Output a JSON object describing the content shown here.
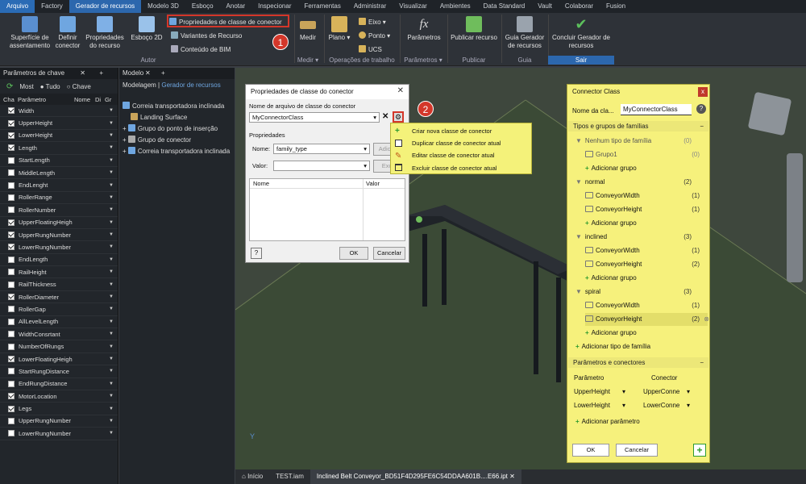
{
  "menubar": [
    "Arquivo",
    "Factory",
    "Gerador de recursos",
    "Modelo 3D",
    "Esboço",
    "Anotar",
    "Inspecionar",
    "Ferramentas",
    "Administrar",
    "Visualizar",
    "Ambientes",
    "Data Standard",
    "Vault",
    "Colaborar",
    "Fusion"
  ],
  "ribbon": {
    "superficie": "Superfície de assentamento",
    "definir": "Definir conector",
    "propriedades": "Propriedades do recurso",
    "esboco2d": "Esboço 2D",
    "prop_classe": "Propriedades de classe de conector",
    "variantes": "Variantes de Recurso",
    "conteudo": "Conteúdo de BIM",
    "autor": "Autor",
    "medir": "Medir",
    "medir_grp": "Medir",
    "plano": "Plano",
    "eixo": "Eixo",
    "ponto": "Ponto",
    "ucs": "UCS",
    "operacoes": "Operações de trabalho",
    "parametros": "Parâmetros",
    "parametros_grp": "Parâmetros",
    "publicar": "Publicar recurso",
    "publicar_grp": "Publicar",
    "guia": "Guia Gerador de recursos",
    "guia_grp": "Guia",
    "concluir": "Concluir Gerador de recursos",
    "sair": "Sair"
  },
  "callouts": [
    "1",
    "2"
  ],
  "leftpanel": {
    "title": "Parâmetros de chave",
    "radio": [
      "Most",
      "Tudo",
      "Chave"
    ],
    "cols": [
      "Cha",
      "Parâmetro",
      "Nome",
      "Di",
      "Gr"
    ],
    "rows": [
      {
        "name": "Width",
        "on": true
      },
      {
        "name": "UpperHeight",
        "on": true
      },
      {
        "name": "LowerHeight",
        "on": true
      },
      {
        "name": "Length",
        "on": true
      },
      {
        "name": "StartLength",
        "on": false
      },
      {
        "name": "MiddleLength",
        "on": false
      },
      {
        "name": "EndLenght",
        "on": false
      },
      {
        "name": "RollerRange",
        "on": false
      },
      {
        "name": "RollerNumber",
        "on": false
      },
      {
        "name": "UpperFloatingHeigh",
        "on": true
      },
      {
        "name": "UpperRungNumber",
        "on": true
      },
      {
        "name": "LowerRungNumber",
        "on": true
      },
      {
        "name": "EndLength",
        "on": false
      },
      {
        "name": "RailHeight",
        "on": false
      },
      {
        "name": "RailThickness",
        "on": false
      },
      {
        "name": "RollerDiameter",
        "on": true
      },
      {
        "name": "RollerGap",
        "on": false
      },
      {
        "name": "AllLevelLength",
        "on": false
      },
      {
        "name": "WidthConsrtant",
        "on": false
      },
      {
        "name": "NumberOfRungs",
        "on": false
      },
      {
        "name": "LowerFloatingHeigh",
        "on": true
      },
      {
        "name": "StartRungDistance",
        "on": false
      },
      {
        "name": "EndRungDistance",
        "on": false
      },
      {
        "name": "MotorLocation",
        "on": true
      },
      {
        "name": "Legs",
        "on": true
      },
      {
        "name": "UpperRungNumber",
        "on": false
      },
      {
        "name": "LowerRungNumber",
        "on": false
      }
    ]
  },
  "modelpanel": {
    "title": "Modelo",
    "tabs": [
      "Modelagem",
      "Gerador de recursos"
    ],
    "tree": [
      "Correia transportadora inclinada",
      "Landing Surface",
      "Grupo do ponto de inserção",
      "Grupo de conector",
      "Correia transportadora inclinada"
    ]
  },
  "dialog": {
    "title": "Propriedades de classe do conector",
    "file_label": "Nome de arquivo de classe do conector",
    "file_value": "MyConnectorClass",
    "props_label": "Propriedades",
    "nome_label": "Nome:",
    "nome_value": "family_type",
    "adic": "Adicio",
    "valor_label": "Valor:",
    "exc": "Exc",
    "col_nome": "Nome",
    "col_valor": "Valor",
    "ok": "OK",
    "cancel": "Cancelar"
  },
  "ctxmenu": [
    "Criar nova classe de conector",
    "Duplicar classe de conector atual",
    "Editar classe de conector atual",
    "Excluir classe de conector atual"
  ],
  "connpanel": {
    "title": "Connector Class",
    "name_label": "Nome da cla...",
    "name_value": "MyConnectorClass",
    "sec1": "Tipos e grupos de famílias",
    "sec2": "Parâmetros e conectores",
    "items": [
      {
        "t": "Nenhum tipo de família",
        "c": "(0)",
        "lvl": 0,
        "kind": "type",
        "grey": true
      },
      {
        "t": "Grupo1",
        "c": "(0)",
        "lvl": 1,
        "kind": "grp",
        "grey": true
      },
      {
        "t": "Adicionar grupo",
        "c": "",
        "lvl": 1,
        "kind": "add"
      },
      {
        "t": "normal",
        "c": "(2)",
        "lvl": 0,
        "kind": "type"
      },
      {
        "t": "ConveyorWidth",
        "c": "(1)",
        "lvl": 1,
        "kind": "grp"
      },
      {
        "t": "ConveyorHeight",
        "c": "(1)",
        "lvl": 1,
        "kind": "grp"
      },
      {
        "t": "Adicionar grupo",
        "c": "",
        "lvl": 1,
        "kind": "add"
      },
      {
        "t": "inclined",
        "c": "(3)",
        "lvl": 0,
        "kind": "type"
      },
      {
        "t": "ConveyorWidth",
        "c": "(1)",
        "lvl": 1,
        "kind": "grp"
      },
      {
        "t": "ConveyorHeight",
        "c": "(2)",
        "lvl": 1,
        "kind": "grp"
      },
      {
        "t": "Adicionar grupo",
        "c": "",
        "lvl": 1,
        "kind": "add"
      },
      {
        "t": "spiral",
        "c": "(3)",
        "lvl": 0,
        "kind": "type"
      },
      {
        "t": "ConveyorWidth",
        "c": "(1)",
        "lvl": 1,
        "kind": "grp"
      },
      {
        "t": "ConveyorHeight",
        "c": "(2)",
        "lvl": 1,
        "kind": "grp",
        "sel": true
      },
      {
        "t": "Adicionar grupo",
        "c": "",
        "lvl": 1,
        "kind": "add"
      },
      {
        "t": "Adicionar tipo de família",
        "c": "",
        "lvl": 0,
        "kind": "add"
      }
    ],
    "param_col": "Parâmetro",
    "conn_col": "Conector",
    "params": [
      {
        "p": "UpperHeight",
        "c": "UpperConne"
      },
      {
        "p": "LowerHeight",
        "c": "LowerConne"
      }
    ],
    "add_param": "Adicionar parâmetro",
    "ok": "OK",
    "cancel": "Cancelar"
  },
  "bottomtabs": [
    "Início",
    "TEST.iam",
    "Inclined Belt Conveyor_BD51F4D295FE6C54DDAA601B....E66.ipt"
  ]
}
